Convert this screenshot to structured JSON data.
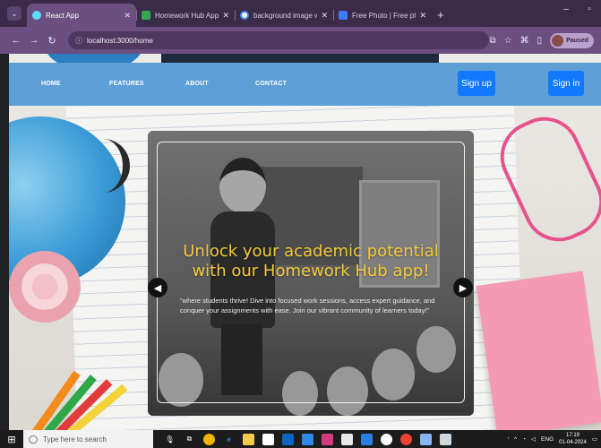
{
  "browser": {
    "tabs": [
      {
        "title": "React App",
        "active": true,
        "favicon_color": "#61dafb"
      },
      {
        "title": "Homework Hub App Efficiently",
        "active": false,
        "favicon_color": "#34a853"
      },
      {
        "title": "background image with colorfu",
        "active": false,
        "favicon_color": "#ffffff"
      },
      {
        "title": "Free Photo | Free photo interna",
        "active": false,
        "favicon_color": "#3d7bff"
      }
    ],
    "new_tab": "+",
    "url": "localhost:3000/home",
    "profile_status": "Paused"
  },
  "navbar": {
    "links": [
      "HOME",
      "FEATURES",
      "ABOUT",
      "CONTACT"
    ],
    "signup_label": "Sign up",
    "signin_label": "Sign in"
  },
  "hero": {
    "headline": "Unlock your academic potential with our Homework Hub app!",
    "description": "\"where students thrive! Dive into focused work sessions, access expert guidance, and conquer your assignments with ease. Join our vibrant community of learners today!\"",
    "prev_arrow": "◀",
    "next_arrow": "▶"
  },
  "taskbar": {
    "search_placeholder": "Type here to search",
    "language": "ENG",
    "time": "17:19",
    "date": "01-04-2024"
  },
  "colors": {
    "navbar_bg": "#5e9fd6",
    "button_bg": "#1178ff",
    "headline": "#f3c93a",
    "browser_frame": "#6b4f80"
  }
}
